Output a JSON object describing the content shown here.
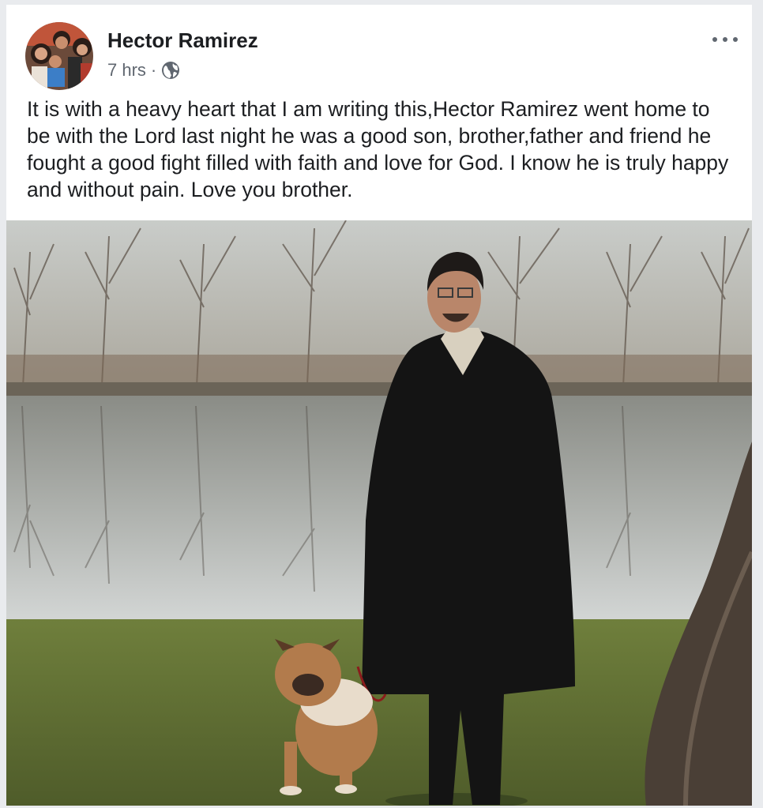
{
  "post": {
    "author": "Hector Ramirez",
    "time": "7 hrs",
    "separator": "·",
    "privacy_icon": "globe-icon",
    "more_icon": "more-options-icon",
    "text": "It is with a heavy heart that I am writing this,Hector Ramirez went home to be with the Lord last night he was a good son, brother,father and friend he fought a good fight filled with faith and love for God.  I know he is truly happy and without pain.  Love you brother."
  },
  "colors": {
    "background": "#e9ebee",
    "card": "#ffffff",
    "text": "#1c1e21",
    "meta": "#606770"
  }
}
